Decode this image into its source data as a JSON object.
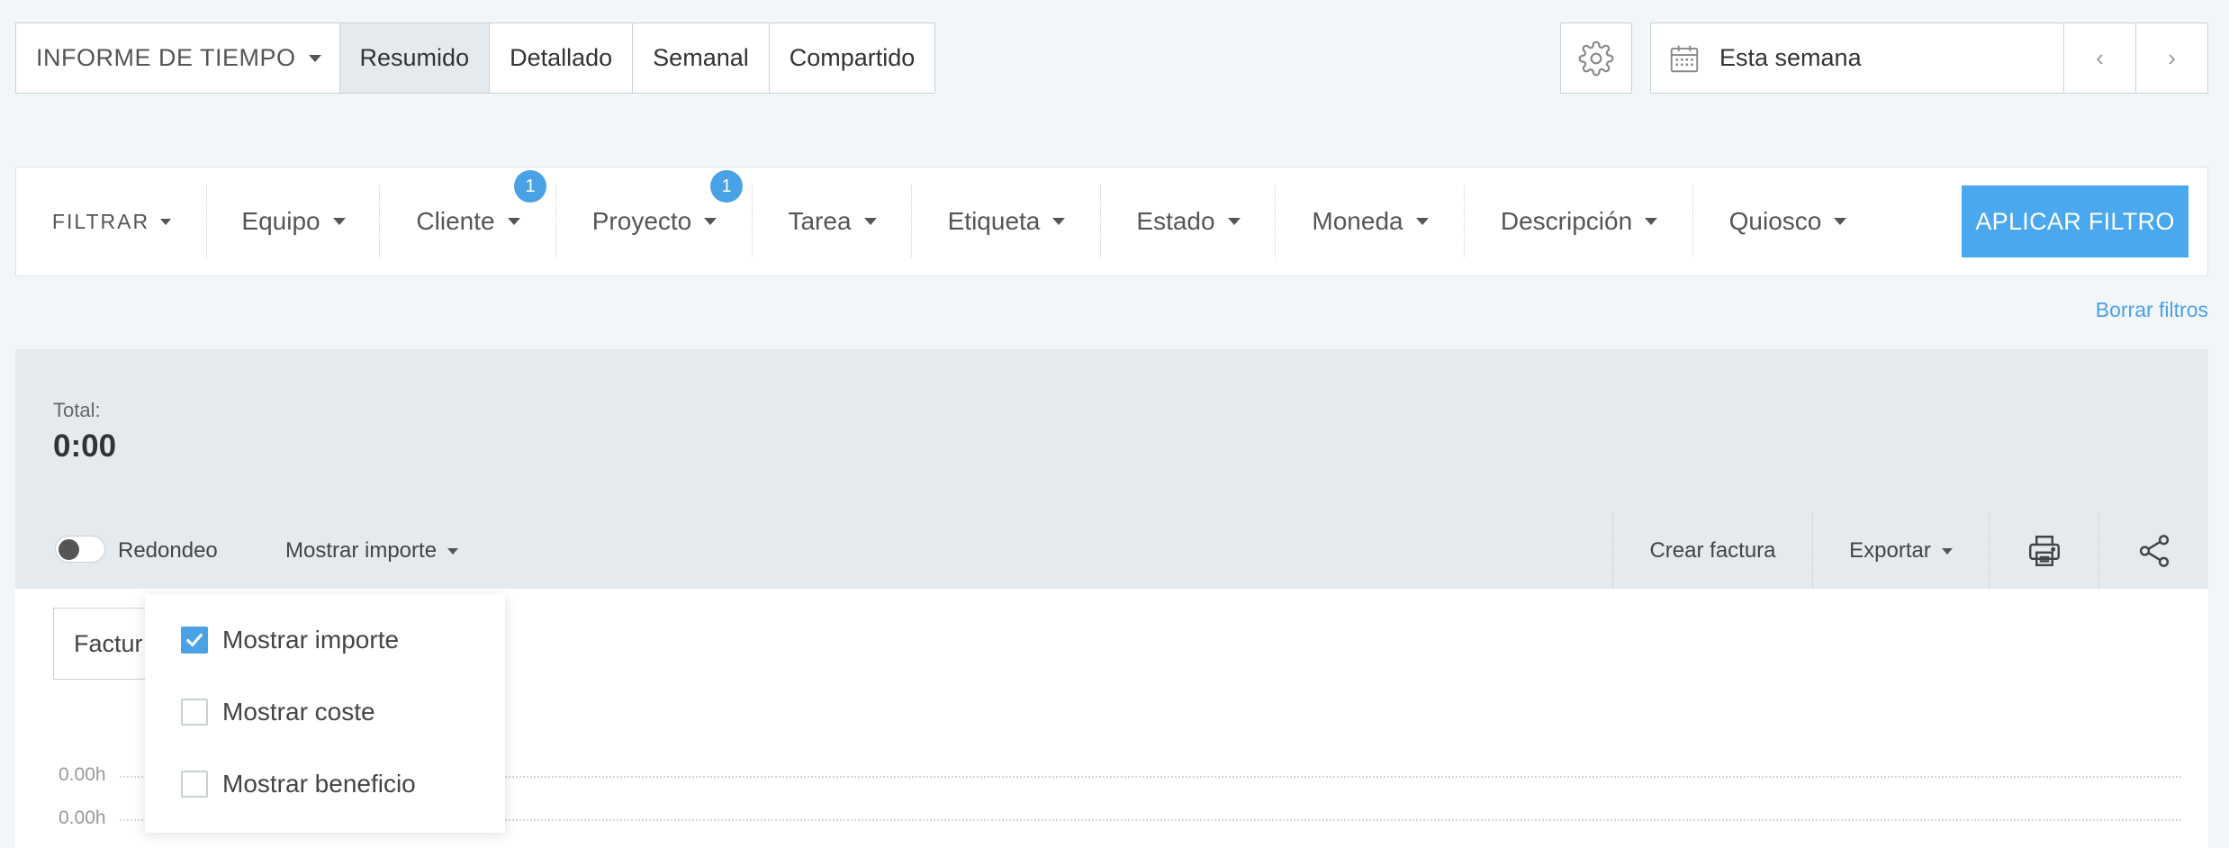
{
  "header": {
    "report_menu": "INFORME DE TIEMPO",
    "tabs": [
      {
        "label": "Resumido",
        "active": true
      },
      {
        "label": "Detallado",
        "active": false
      },
      {
        "label": "Semanal",
        "active": false
      },
      {
        "label": "Compartido",
        "active": false
      }
    ],
    "date_range": "Esta semana",
    "prev": "‹",
    "next": "›",
    "icons": {
      "settings": "gear-icon",
      "calendar": "calendar-icon"
    }
  },
  "filters": {
    "label": "FILTRAR",
    "items": [
      {
        "label": "Equipo",
        "badge": ""
      },
      {
        "label": "Cliente",
        "badge": "1"
      },
      {
        "label": "Proyecto",
        "badge": "1"
      },
      {
        "label": "Tarea",
        "badge": ""
      },
      {
        "label": "Etiqueta",
        "badge": ""
      },
      {
        "label": "Estado",
        "badge": ""
      },
      {
        "label": "Moneda",
        "badge": ""
      },
      {
        "label": "Descripción",
        "badge": ""
      },
      {
        "label": "Quiosco",
        "badge": ""
      }
    ],
    "apply": "APLICAR FILTRO",
    "clear": "Borrar filtros",
    "accent": "#4aa8ee"
  },
  "summary": {
    "total_label": "Total:",
    "total_value": "0:00",
    "rounding_label": "Redondeo",
    "rounding_on": false,
    "show_amount": "Mostrar importe",
    "actions": {
      "invoice": "Crear factura",
      "export": "Exportar",
      "print_icon": "printer-icon",
      "share_icon": "share-icon"
    }
  },
  "chart": {
    "group_by": "Factur",
    "axis_labels": [
      "0.00h",
      "0.00h"
    ]
  },
  "dropdown": {
    "options": [
      {
        "label": "Mostrar importe",
        "checked": true
      },
      {
        "label": "Mostrar coste",
        "checked": false
      },
      {
        "label": "Mostrar beneficio",
        "checked": false
      }
    ]
  }
}
